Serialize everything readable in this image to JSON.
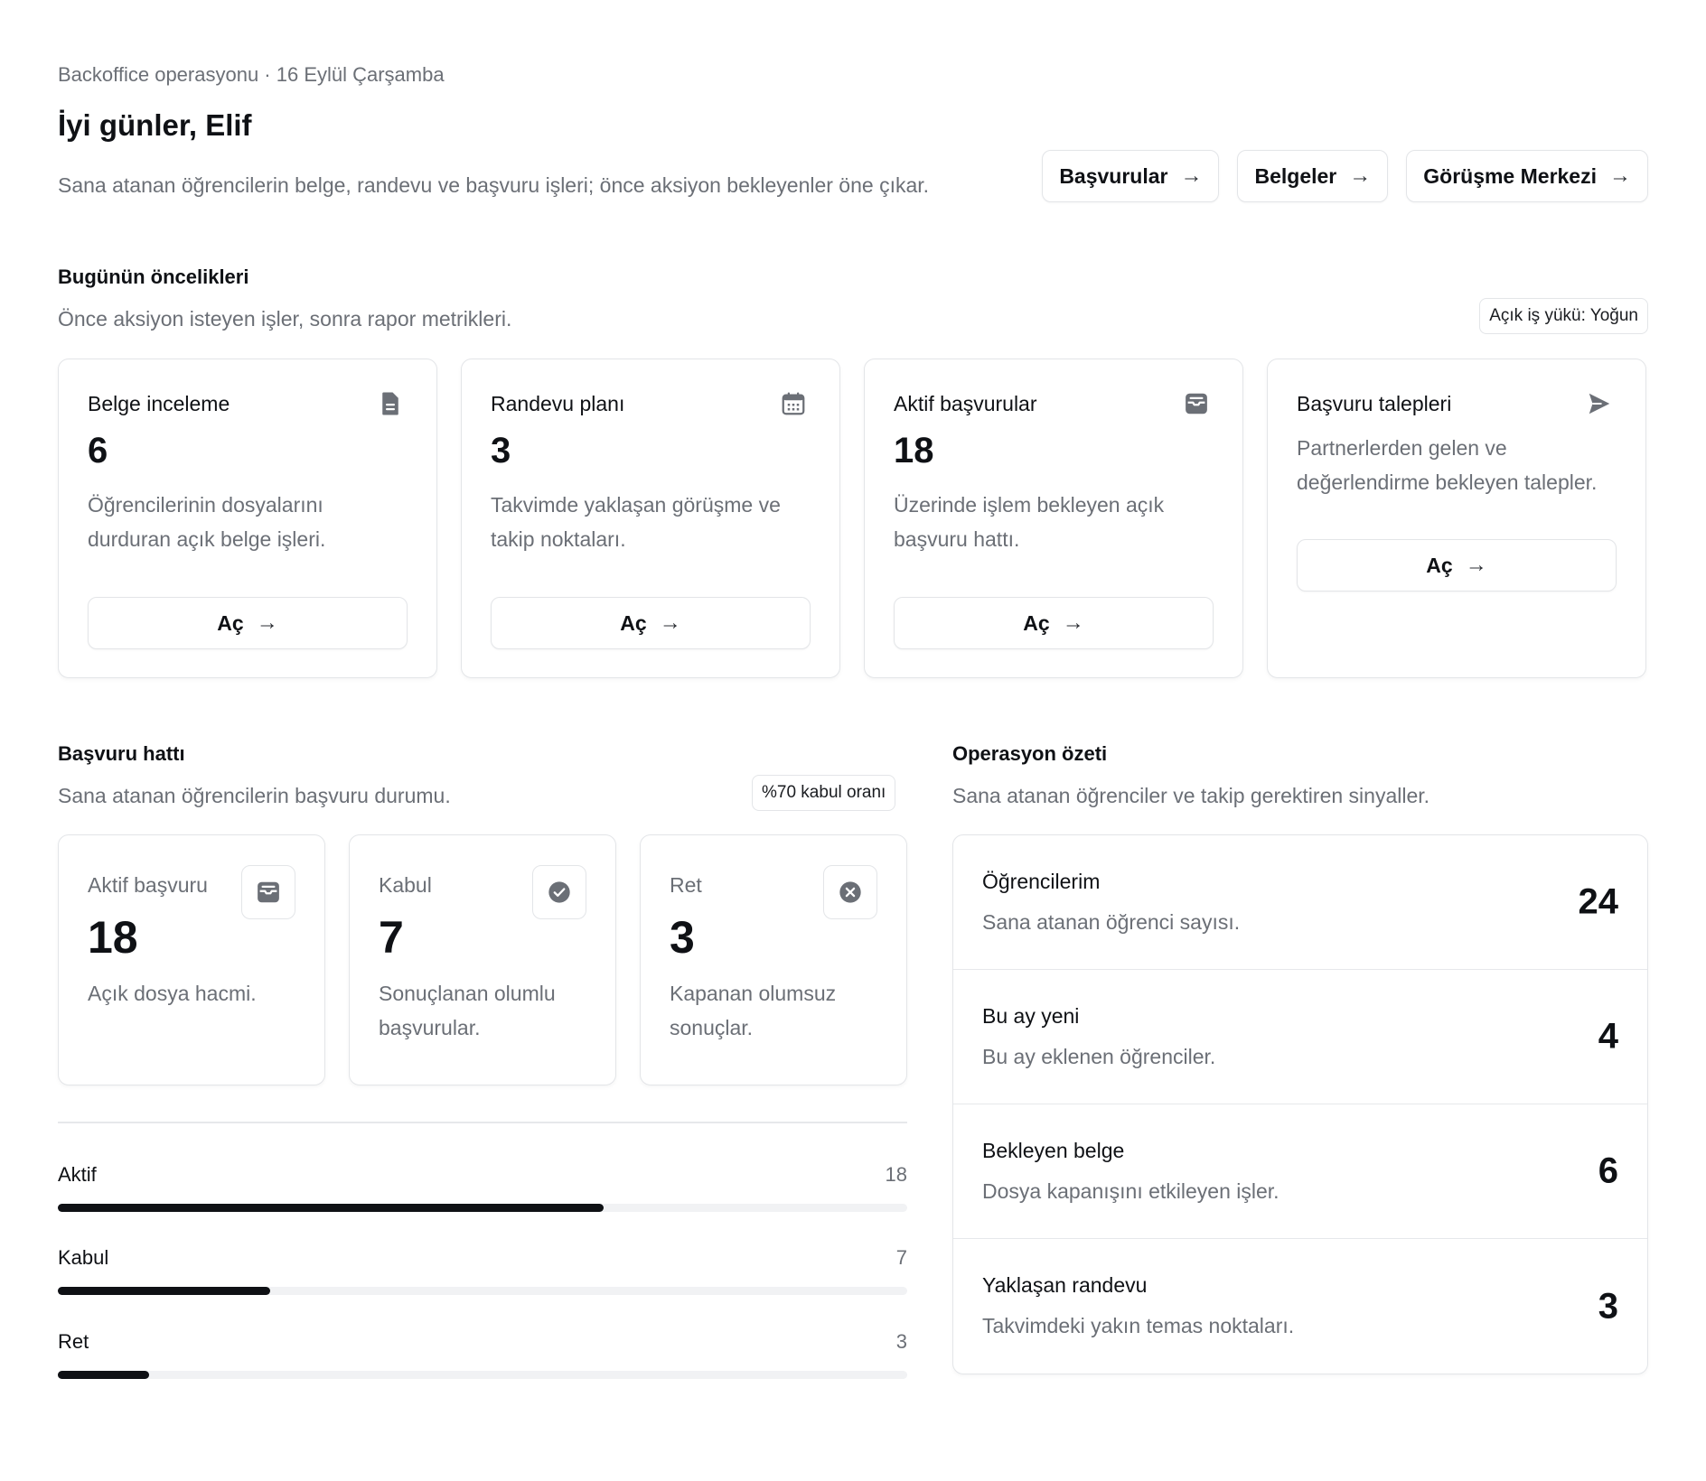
{
  "header": {
    "eyebrow": "Backoffice operasyonu · 16 Eylül Çarşamba",
    "greeting": "İyi günler, Elif",
    "intro": "Sana atanan öğrencilerin belge, randevu ve başvuru işleri; önce aksiyon bekleyenler öne çıkar.",
    "actions": [
      {
        "label": "Başvurular",
        "icon": "arrow-right-icon"
      },
      {
        "label": "Belgeler",
        "icon": "arrow-right-icon"
      },
      {
        "label": "Görüşme Merkezi",
        "icon": "arrow-right-icon"
      }
    ]
  },
  "arrow_glyph": "→",
  "priorities": {
    "title": "Bugünün öncelikleri",
    "subtitle": "Önce aksiyon isteyen işler, sonra rapor metrikleri.",
    "badge": "Açık iş yükü: Yoğun",
    "cards": [
      {
        "title": "Belge inceleme",
        "value": "6",
        "desc": "Öğrencilerinin dosyalarını durduran açık belge işleri.",
        "icon": "document-icon",
        "button": "Aç"
      },
      {
        "title": "Randevu planı",
        "value": "3",
        "desc": "Takvimde yaklaşan görüşme ve takip noktaları.",
        "icon": "calendar-icon",
        "button": "Aç"
      },
      {
        "title": "Aktif başvurular",
        "value": "18",
        "desc": "Üzerinde işlem bekleyen açık başvuru hattı.",
        "icon": "inbox-icon",
        "button": "Aç"
      },
      {
        "title": "Başvuru talepleri",
        "desc": "Partnerlerden gelen ve değerlendirme bekleyen talepler.",
        "icon": "send-icon",
        "button": "Aç"
      }
    ]
  },
  "pipeline": {
    "title": "Başvuru hattı",
    "subtitle": "Sana atanan öğrencilerin başvuru durumu.",
    "badge": "%70 kabul oranı",
    "stats": [
      {
        "label": "Aktif başvuru",
        "value": "18",
        "desc": "Açık dosya hacmi.",
        "icon": "inbox-icon"
      },
      {
        "label": "Kabul",
        "value": "7",
        "desc": "Sonuçlanan olumlu başvurular.",
        "icon": "check-circle-icon"
      },
      {
        "label": "Ret",
        "value": "3",
        "desc": "Kapanan olumsuz sonuçlar.",
        "icon": "x-circle-icon"
      }
    ],
    "bars": [
      {
        "label": "Aktif",
        "value": 18,
        "value_text": "18",
        "fraction": 0.643
      },
      {
        "label": "Kabul",
        "value": 7,
        "value_text": "7",
        "fraction": 0.25
      },
      {
        "label": "Ret",
        "value": 3,
        "value_text": "3",
        "fraction": 0.107
      }
    ]
  },
  "operations": {
    "title": "Operasyon özeti",
    "subtitle": "Sana atanan öğrenciler ve takip gerektiren sinyaller.",
    "rows": [
      {
        "title": "Öğrencilerim",
        "desc": "Sana atanan öğrenci sayısı.",
        "value": "24"
      },
      {
        "title": "Bu ay yeni",
        "desc": "Bu ay eklenen öğrenciler.",
        "value": "4"
      },
      {
        "title": "Bekleyen belge",
        "desc": "Dosya kapanışını etkileyen işler.",
        "value": "6"
      },
      {
        "title": "Yaklaşan randevu",
        "desc": "Takvimdeki yakın temas noktaları.",
        "value": "3"
      }
    ]
  }
}
